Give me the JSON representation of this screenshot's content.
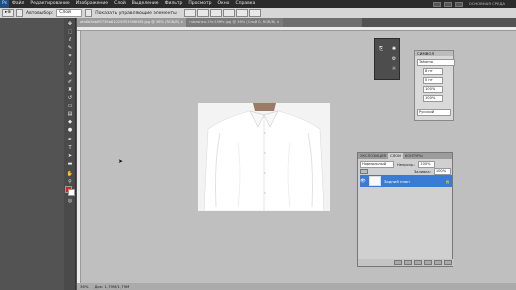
{
  "menu": {
    "items": [
      "Файл",
      "Редактирование",
      "Изображение",
      "Слой",
      "Выделение",
      "Фильтр",
      "Просмотр",
      "Окно",
      "Справка"
    ],
    "right_text": "ОСНОВНАЯ СРЕДА"
  },
  "options": {
    "tool_glyph": "▸⊕",
    "autoselect_label": "Автовыбор:",
    "autoselect_value": "Слой",
    "transform_label": "Показать управляющие элементы"
  },
  "document": {
    "tabs": [
      {
        "label": "afa8b5bbff5739a61025ff53396f4f5.jpg @ 36% (RGB/8) ×",
        "active": true
      },
      {
        "label": "rubashka-19r-55fffc.jpg @ 36% (Слой 0, RGB/8) ×",
        "active": false
      }
    ],
    "status_zoom": "36%",
    "status_doc": "Док: 1,79М/1,79М"
  },
  "character": {
    "title": "СИМВОЛ",
    "font": "Tahoma",
    "size": "8 пт",
    "leading": "100%",
    "tracking": "0 пт",
    "language": "Русский"
  },
  "layers": {
    "tabs": [
      "ЭКСПОЗИЦИЯ",
      "СЛОИ",
      "КОНТУРЫ"
    ],
    "blend_mode": "Нормальный",
    "opacity_label": "Непрозр.:",
    "opacity_value": "100%",
    "fill_label": "Заливка:",
    "fill_value": "100%",
    "layer_name": "Задний план"
  },
  "colors": {
    "foreground": "#d2271a",
    "background": "#ffffff",
    "selection": "#3a7bd5"
  }
}
